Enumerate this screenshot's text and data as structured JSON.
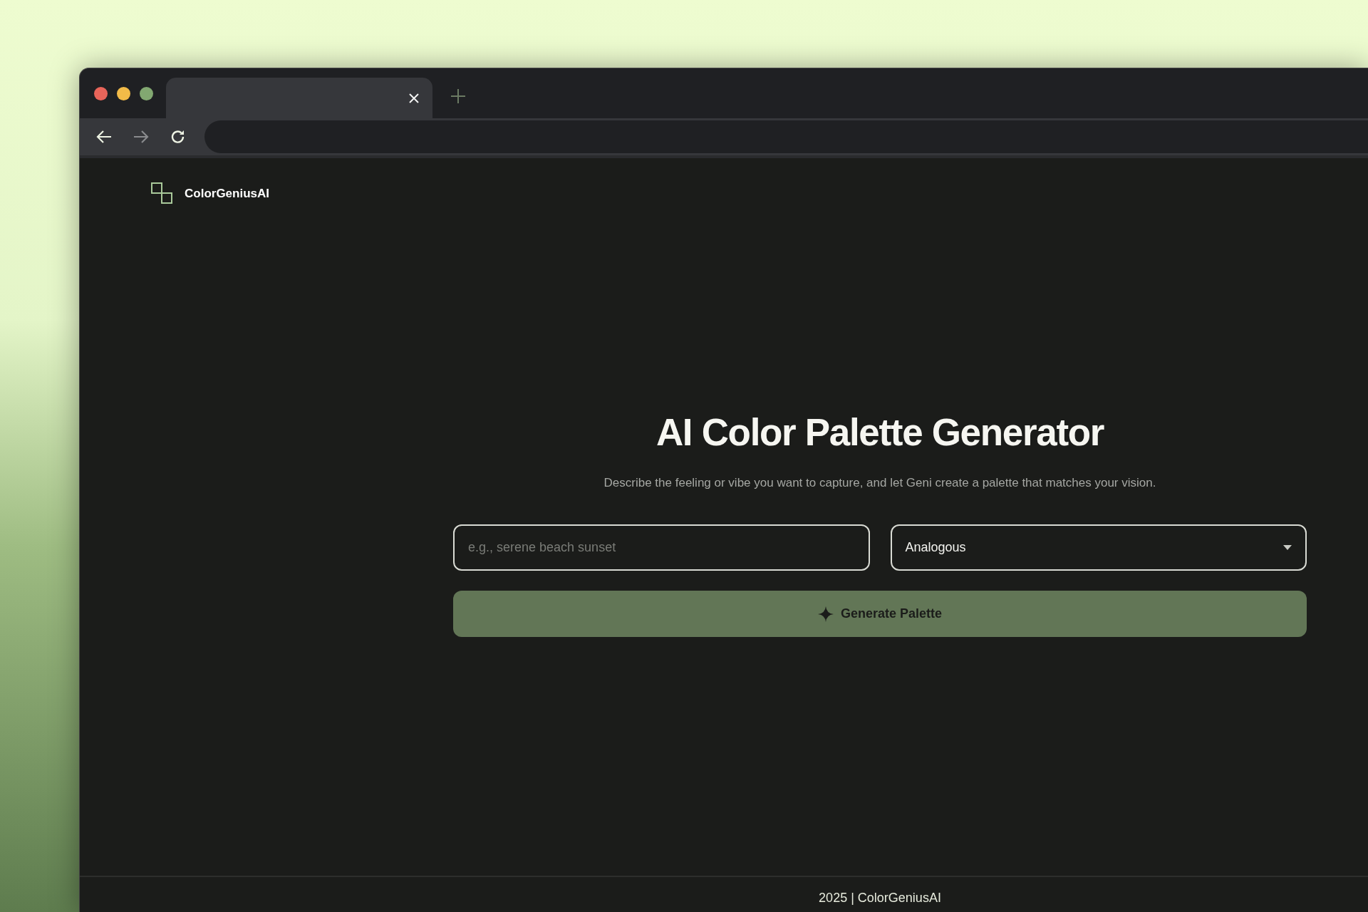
{
  "brand": {
    "name": "ColorGeniusAI"
  },
  "hero": {
    "title": "AI Color Palette Generator",
    "subtitle": "Describe the feeling or vibe you want to capture, and let Geni create a palette that matches your vision."
  },
  "prompt_field": {
    "placeholder": "e.g., serene beach sunset"
  },
  "harmony_select": {
    "value": "Analogous"
  },
  "generate_button": {
    "label": "Generate Palette"
  },
  "footer": {
    "text": "2025 | ColorGeniusAI"
  }
}
